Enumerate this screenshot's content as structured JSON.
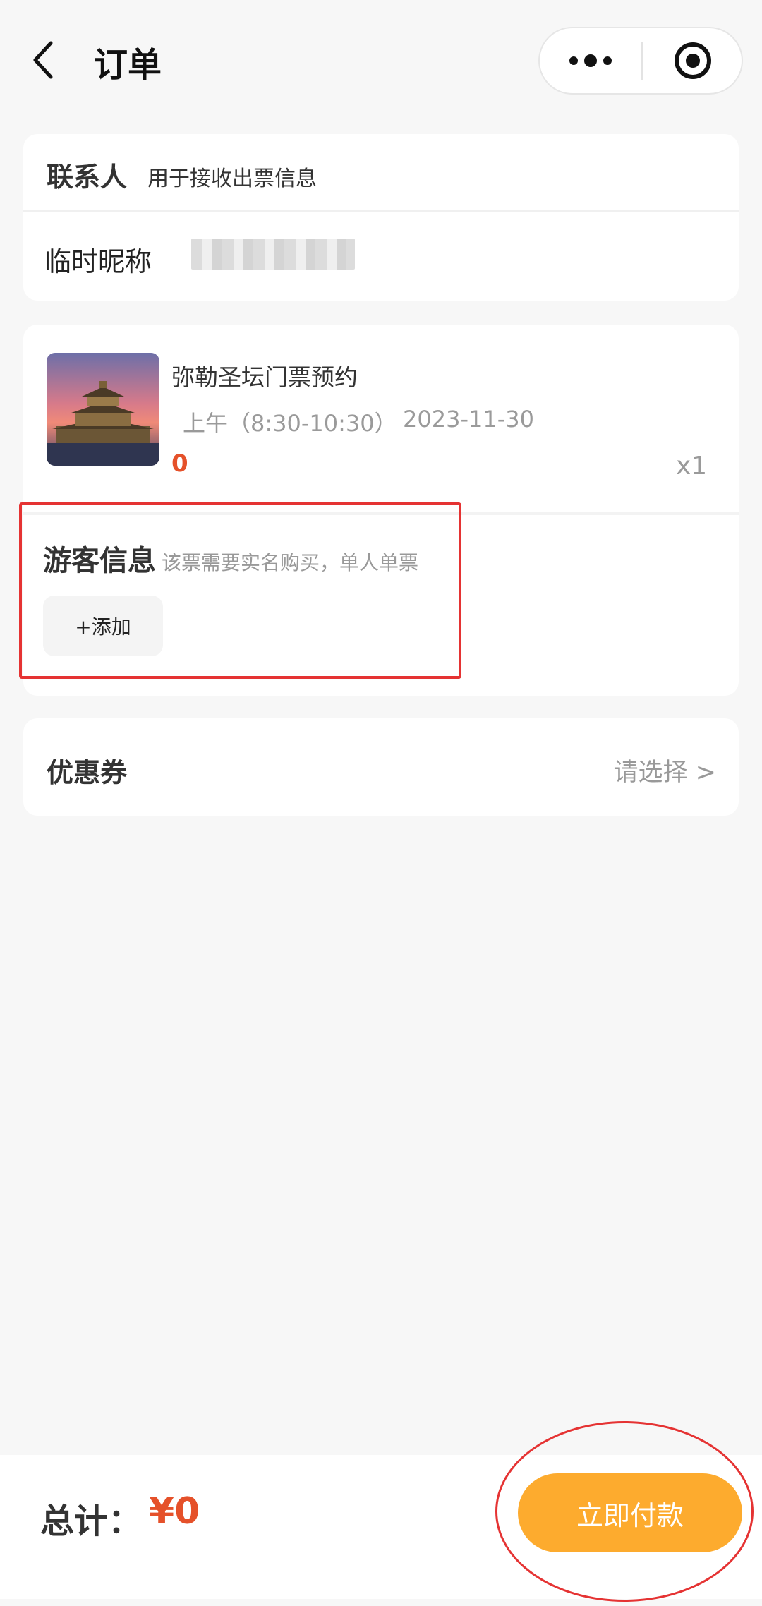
{
  "nav": {
    "title": "订单"
  },
  "contact": {
    "title": "联系人",
    "subtitle": "用于接收出票信息",
    "nickname_label": "临时昵称"
  },
  "ticket": {
    "name": "弥勒圣坛门票预约",
    "time_slot": "上午（8:30-10:30）",
    "date": "2023-11-30",
    "price": "0",
    "quantity": "x1"
  },
  "visitor": {
    "title": "游客信息",
    "subtitle": "该票需要实名购买，单人单票",
    "add_label": "+添加"
  },
  "coupon": {
    "title": "优惠券",
    "select_label": "请选择 >"
  },
  "footer": {
    "total_label": "总计：",
    "total_value": "¥0",
    "pay_label": "立即付款"
  },
  "colors": {
    "accent_price": "#e5512a",
    "pay_button": "#fdab2e",
    "annotation_red": "#e53333"
  }
}
